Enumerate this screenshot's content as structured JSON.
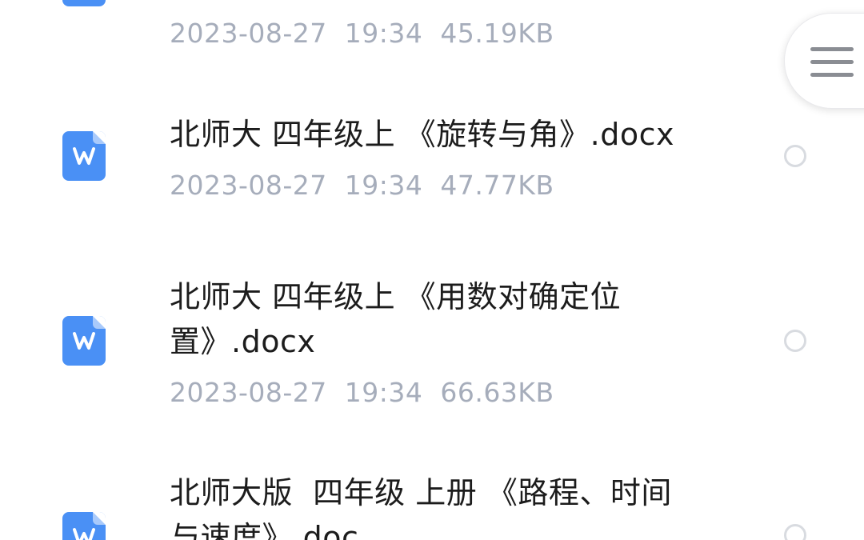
{
  "files": [
    {
      "name": "",
      "meta": "2023-08-27  19:34  45.19KB",
      "icon": "word-doc-icon"
    },
    {
      "name": "北师大 四年级上 《旋转与角》.docx",
      "meta": "2023-08-27  19:34  47.77KB",
      "icon": "word-doc-icon"
    },
    {
      "name": "北师大 四年级上 《用数对确定位\n置》.docx",
      "meta": "2023-08-27  19:34  66.63KB",
      "icon": "word-doc-icon"
    },
    {
      "name": "北师大版  四年级 上册 《路程、时间\n与速度》.doc",
      "meta": "",
      "icon": "word-doc-icon"
    }
  ],
  "menu": {
    "icon": "hamburger-menu-icon"
  },
  "colors": {
    "icon_blue": "#4a90f5",
    "meta_gray": "#a6adbb",
    "text_dark": "#1c1c1c",
    "radio_border": "#d8dbe0"
  }
}
